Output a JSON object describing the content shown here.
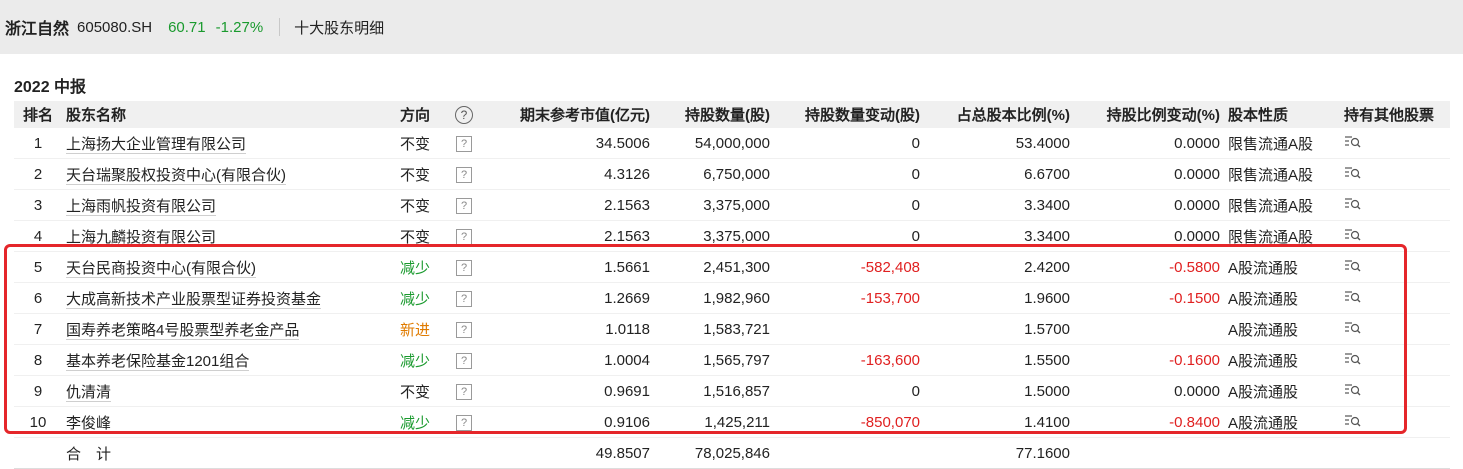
{
  "header": {
    "stock_name": "浙江自然",
    "stock_code": "605080.SH",
    "price": "60.71",
    "change": "-1.27%",
    "section": "十大股东明细"
  },
  "period": "2022 中报",
  "columns": [
    "排名",
    "股东名称",
    "方向",
    "?",
    "期末参考市值(亿元)",
    "持股数量(股)",
    "持股数量变动(股)",
    "占总股本比例(%)",
    "持股比例变动(%)",
    "股本性质",
    "持有其他股票"
  ],
  "rows": [
    {
      "rank": "1",
      "name": "上海扬大企业管理有限公司",
      "dir": "不变",
      "dir_type": "same",
      "mv": "34.5006",
      "shares": "54,000,000",
      "chg": "0",
      "pct": "53.4000",
      "pctchg": "0.0000",
      "nature": "限售流通A股"
    },
    {
      "rank": "2",
      "name": "天台瑞聚股权投资中心(有限合伙)",
      "dir": "不变",
      "dir_type": "same",
      "mv": "4.3126",
      "shares": "6,750,000",
      "chg": "0",
      "pct": "6.6700",
      "pctchg": "0.0000",
      "nature": "限售流通A股"
    },
    {
      "rank": "3",
      "name": "上海雨帆投资有限公司",
      "dir": "不变",
      "dir_type": "same",
      "mv": "2.1563",
      "shares": "3,375,000",
      "chg": "0",
      "pct": "3.3400",
      "pctchg": "0.0000",
      "nature": "限售流通A股"
    },
    {
      "rank": "4",
      "name": "上海九麟投资有限公司",
      "dir": "不变",
      "dir_type": "same",
      "mv": "2.1563",
      "shares": "3,375,000",
      "chg": "0",
      "pct": "3.3400",
      "pctchg": "0.0000",
      "nature": "限售流通A股"
    },
    {
      "rank": "5",
      "name": "天台民商投资中心(有限合伙)",
      "dir": "减少",
      "dir_type": "down",
      "mv": "1.5661",
      "shares": "2,451,300",
      "chg": "-582,408",
      "pct": "2.4200",
      "pctchg": "-0.5800",
      "nature": "A股流通股"
    },
    {
      "rank": "6",
      "name": "大成高新技术产业股票型证券投资基金",
      "dir": "减少",
      "dir_type": "down",
      "mv": "1.2669",
      "shares": "1,982,960",
      "chg": "-153,700",
      "pct": "1.9600",
      "pctchg": "-0.1500",
      "nature": "A股流通股"
    },
    {
      "rank": "7",
      "name": "国寿养老策略4号股票型养老金产品",
      "dir": "新进",
      "dir_type": "new",
      "mv": "1.0118",
      "shares": "1,583,721",
      "chg": "",
      "pct": "1.5700",
      "pctchg": "",
      "nature": "A股流通股"
    },
    {
      "rank": "8",
      "name": "基本养老保险基金1201组合",
      "dir": "减少",
      "dir_type": "down",
      "mv": "1.0004",
      "shares": "1,565,797",
      "chg": "-163,600",
      "pct": "1.5500",
      "pctchg": "-0.1600",
      "nature": "A股流通股"
    },
    {
      "rank": "9",
      "name": "仇清清",
      "dir": "不变",
      "dir_type": "same",
      "mv": "0.9691",
      "shares": "1,516,857",
      "chg": "0",
      "pct": "1.5000",
      "pctchg": "0.0000",
      "nature": "A股流通股"
    },
    {
      "rank": "10",
      "name": "李俊峰",
      "dir": "减少",
      "dir_type": "down",
      "mv": "0.9106",
      "shares": "1,425,211",
      "chg": "-850,070",
      "pct": "1.4100",
      "pctchg": "-0.8400",
      "nature": "A股流通股"
    }
  ],
  "total": {
    "label": "合　计",
    "mv": "49.8507",
    "shares": "78,025,846",
    "pct": "77.1600"
  },
  "colors": {
    "highlight": "#e5262a",
    "green": "#1a9a2e",
    "red": "#e02020",
    "orange": "#e07b00"
  }
}
